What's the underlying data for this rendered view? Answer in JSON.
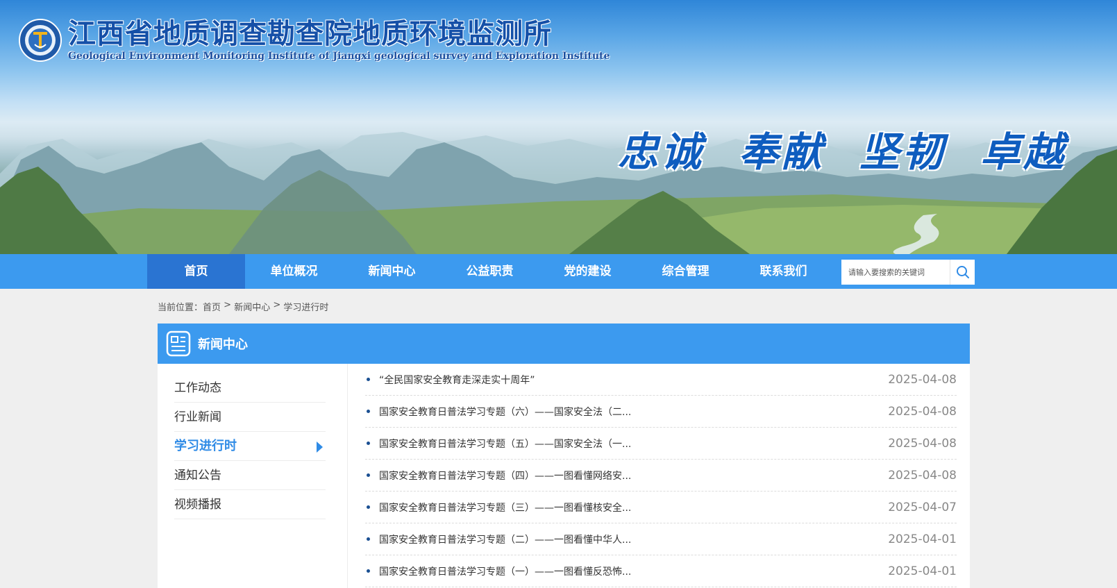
{
  "header": {
    "site_title": "江西省地质调查勘查院地质环境监测所",
    "site_subtitle": "Geological Environment Monitoring Institute of Jiangxi geological survey and Exploration Institute",
    "slogan": [
      "忠诚",
      "奉献",
      "坚韧",
      "卓越"
    ]
  },
  "nav": {
    "items": [
      {
        "label": "首页",
        "active": true
      },
      {
        "label": "单位概况"
      },
      {
        "label": "新闻中心"
      },
      {
        "label": "公益职责"
      },
      {
        "label": "党的建设"
      },
      {
        "label": "综合管理"
      },
      {
        "label": "联系我们"
      }
    ],
    "search_placeholder": "请输入要搜索的关键词",
    "search_icon": "search-icon"
  },
  "breadcrumb": {
    "prefix": "当前位置：",
    "items": [
      "首页",
      "新闻中心",
      "学习进行时"
    ],
    "separator": " > "
  },
  "section": {
    "title": "新闻中心",
    "icon": "news-icon"
  },
  "sidebar": {
    "items": [
      {
        "label": "工作动态"
      },
      {
        "label": "行业新闻"
      },
      {
        "label": "学习进行时",
        "active": true
      },
      {
        "label": "通知公告"
      },
      {
        "label": "视频播报"
      }
    ]
  },
  "news": [
    {
      "title": "“全民国家安全教育走深走实十周年”",
      "date": "2025-04-08"
    },
    {
      "title": "国家安全教育日普法学习专题（六）——国家安全法（二...",
      "date": "2025-04-08"
    },
    {
      "title": "国家安全教育日普法学习专题（五）——国家安全法（一...",
      "date": "2025-04-08"
    },
    {
      "title": "国家安全教育日普法学习专题（四）——一图看懂网络安...",
      "date": "2025-04-08"
    },
    {
      "title": "国家安全教育日普法学习专题（三）——一图看懂核安全...",
      "date": "2025-04-07"
    },
    {
      "title": "国家安全教育日普法学习专题（二）——一图看懂中华人...",
      "date": "2025-04-01"
    },
    {
      "title": "国家安全教育日普法学习专题（一）——一图看懂反恐怖...",
      "date": "2025-04-01"
    }
  ],
  "colors": {
    "nav_bg": "#3c9aef",
    "nav_active": "#2a74d2",
    "accent": "#2f8be6",
    "title_blue": "#1550a8"
  }
}
